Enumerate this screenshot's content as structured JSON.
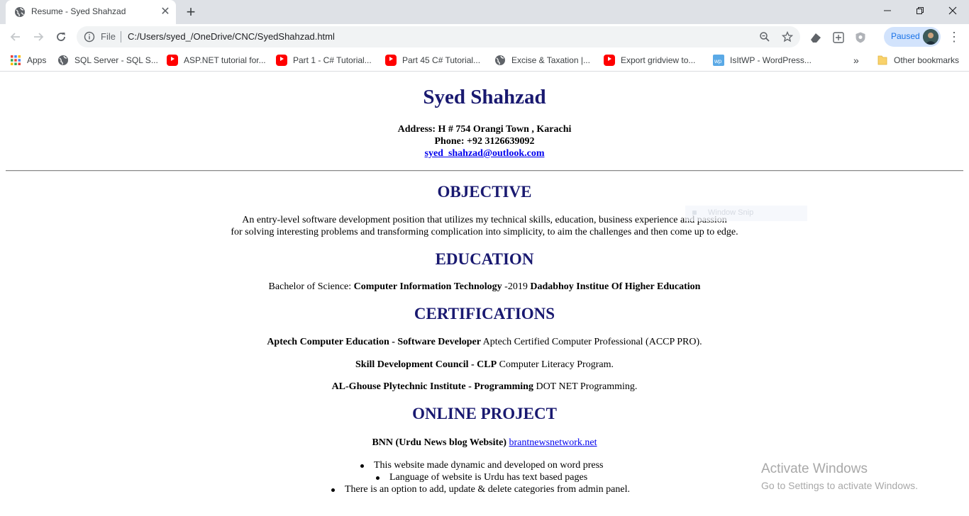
{
  "browser": {
    "tab": {
      "title": "Resume - Syed Shahzad"
    },
    "address": {
      "scheme_label": "File",
      "url": "C:/Users/syed_/OneDrive/CNC/SyedShahzad.html"
    },
    "profile": {
      "label": "Paused"
    },
    "bookmarks": [
      {
        "label": "Apps",
        "icon": "apps-grid-icon"
      },
      {
        "label": "SQL Server - SQL S...",
        "icon": "globe-icon"
      },
      {
        "label": "ASP.NET tutorial for...",
        "icon": "youtube-icon"
      },
      {
        "label": "Part 1 - C# Tutorial...",
        "icon": "youtube-icon"
      },
      {
        "label": "Part 45 C# Tutorial...",
        "icon": "youtube-icon"
      },
      {
        "label": "Excise & Taxation |...",
        "icon": "globe-icon"
      },
      {
        "label": "Export gridview to...",
        "icon": "youtube-icon"
      },
      {
        "label": "IsItWP - WordPress...",
        "icon": "wp-icon"
      }
    ],
    "overflow_label": "»",
    "other_bookmarks": "Other bookmarks",
    "colors": {
      "tabstrip": "#dee1e6",
      "omnibox": "#f1f3f4",
      "profile_bg": "#d2e3fc",
      "accent": "#1a73e8"
    }
  },
  "resume": {
    "name": "Syed Shahzad",
    "address": "Address: H # 754 Orangi Town , Karachi",
    "phone": "Phone: +92 3126639092",
    "email": "syed_shahzad@outlook.com",
    "heading_color": "#191970",
    "objective": {
      "heading": "OBJECTIVE",
      "line1": "An entry-level software development position that utilizes my technical skills, education, business experience and passion",
      "line2": "for solving interesting problems and transforming complication into simplicity, to aim the challenges and then come up to edge."
    },
    "education": {
      "heading": "EDUCATION",
      "degree_prefix": "Bachelor of Science: ",
      "field": "Computer Information Technology",
      "year": " -2019 ",
      "institute": "Dadabhoy Institue Of Higher Education"
    },
    "certifications": {
      "heading": "CERTIFICATIONS",
      "items": [
        {
          "title": "Aptech Computer Education - Software Developer",
          "desc": " Aptech Certified Computer Professional (ACCP PRO)."
        },
        {
          "title": "Skill Development Council - CLP",
          "desc": " Computer Literacy Program."
        },
        {
          "title": "AL-Ghouse Plytechnic Institute - Programming",
          "desc": " DOT NET Programming."
        }
      ]
    },
    "online_project": {
      "heading": "ONLINE PROJECT",
      "title": "BNN (Urdu News blog Website) ",
      "link": "brantnewsnetwork.net",
      "bullets": [
        "This website made dynamic and developed on word press",
        "Language of website is Urdu has text based pages",
        "There is an option to add, update & delete categories from admin panel."
      ]
    }
  },
  "overlay": {
    "snip_label": "Window Snip",
    "watermark_title": "Activate Windows",
    "watermark_sub": "Go to Settings to activate Windows."
  }
}
